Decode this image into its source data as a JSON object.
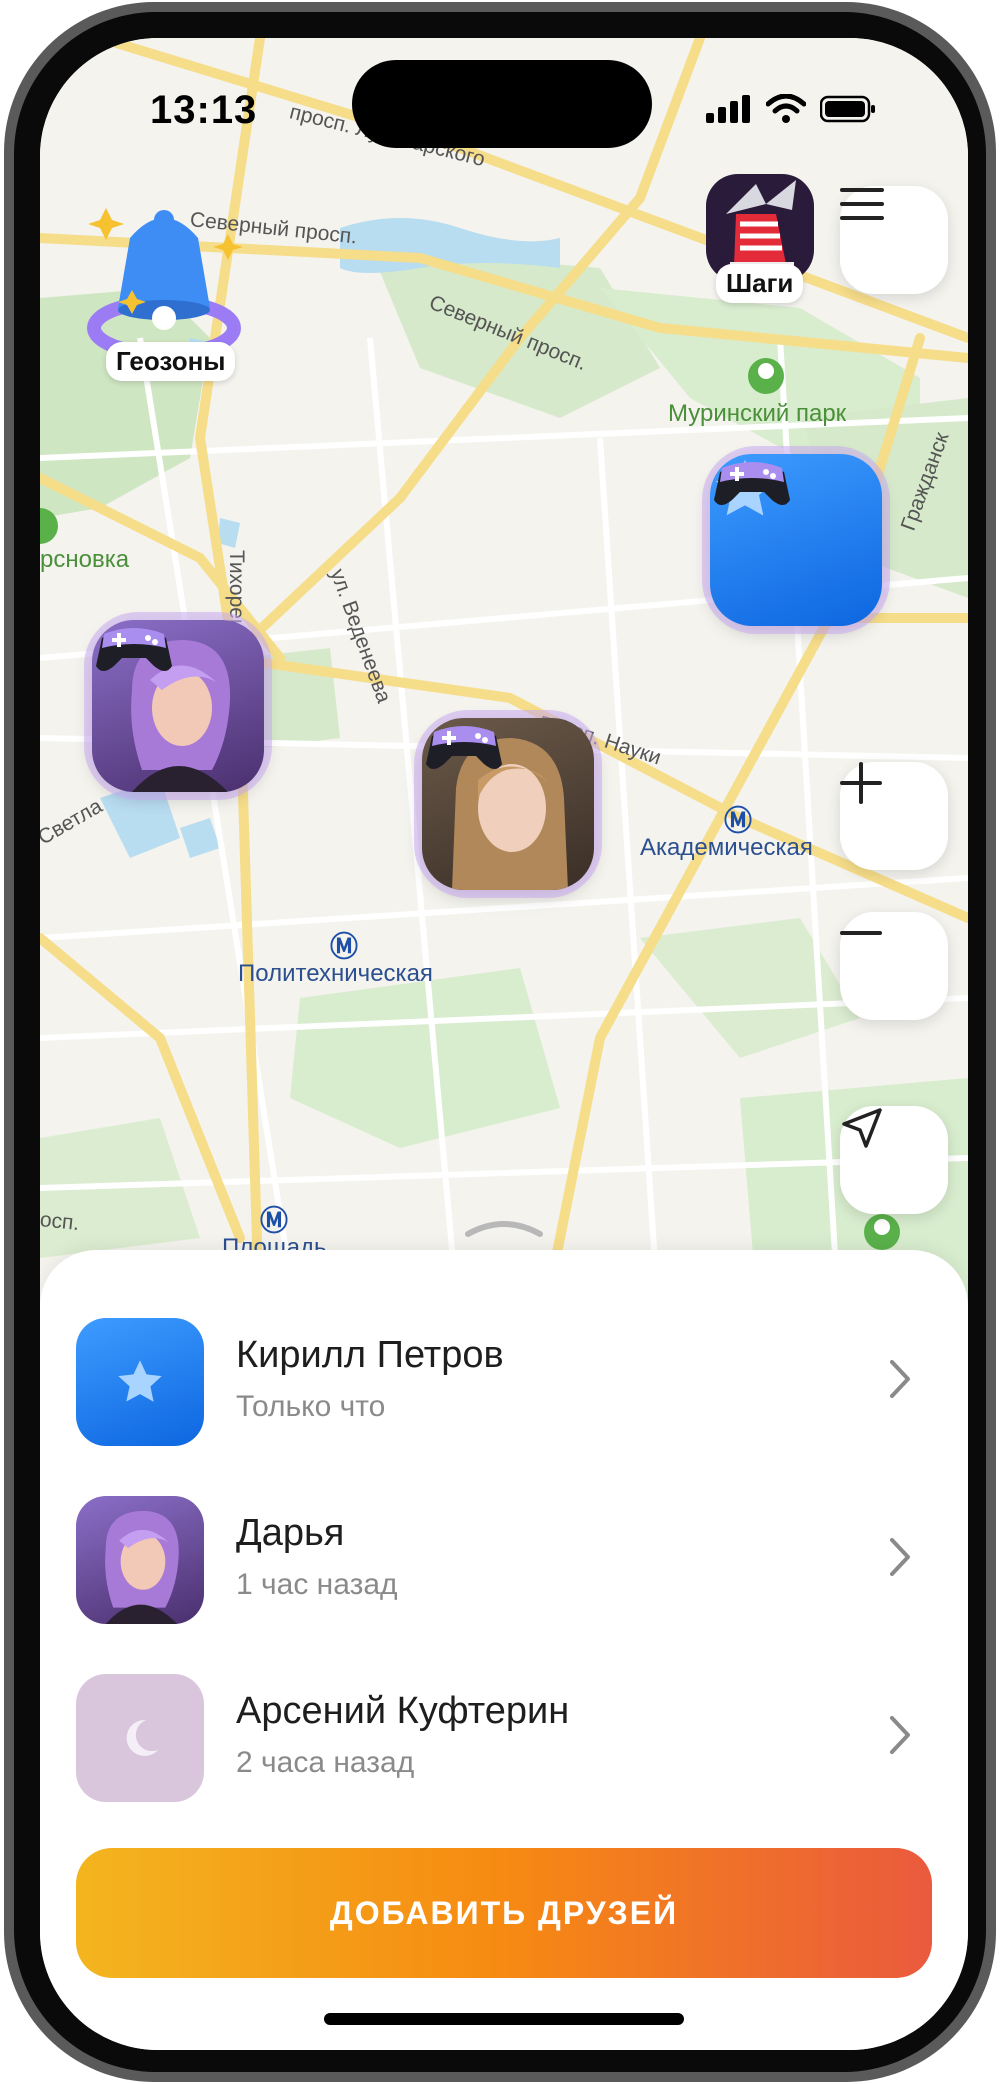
{
  "status_bar": {
    "time": "13:13"
  },
  "map": {
    "streets": [
      "просп. Луначарского",
      "Северный просп.",
      "Северный просп.",
      "Тихорецкий просп.",
      "ул. Веденеева",
      "просп. Науки",
      "Светла",
      "Гражданск",
      "осп."
    ],
    "parks": [
      "Муринский парк",
      "рсновка"
    ],
    "metro": [
      "Академическая",
      "Политехническая",
      "Площадь"
    ],
    "geozones_label": "Геозоны",
    "steps_label": "Шаги"
  },
  "friends": [
    {
      "name": "Кирилл Петров",
      "time": "Только что",
      "avatar": "star-icon"
    },
    {
      "name": "Дарья",
      "time": "1 час назад",
      "avatar": "user-photo"
    },
    {
      "name": "Арсений Куфтерин",
      "time": "2 часа назад",
      "avatar": "moon-icon"
    }
  ],
  "add_friends_label": "ДОБАВИТЬ ДРУЗЕЙ",
  "colors": {
    "accent_blue": "#1a7cf0",
    "button_gradient": [
      "#f3b51f",
      "#f68a12",
      "#ea5a3e"
    ],
    "marker_glow": "#c8aaf0"
  }
}
